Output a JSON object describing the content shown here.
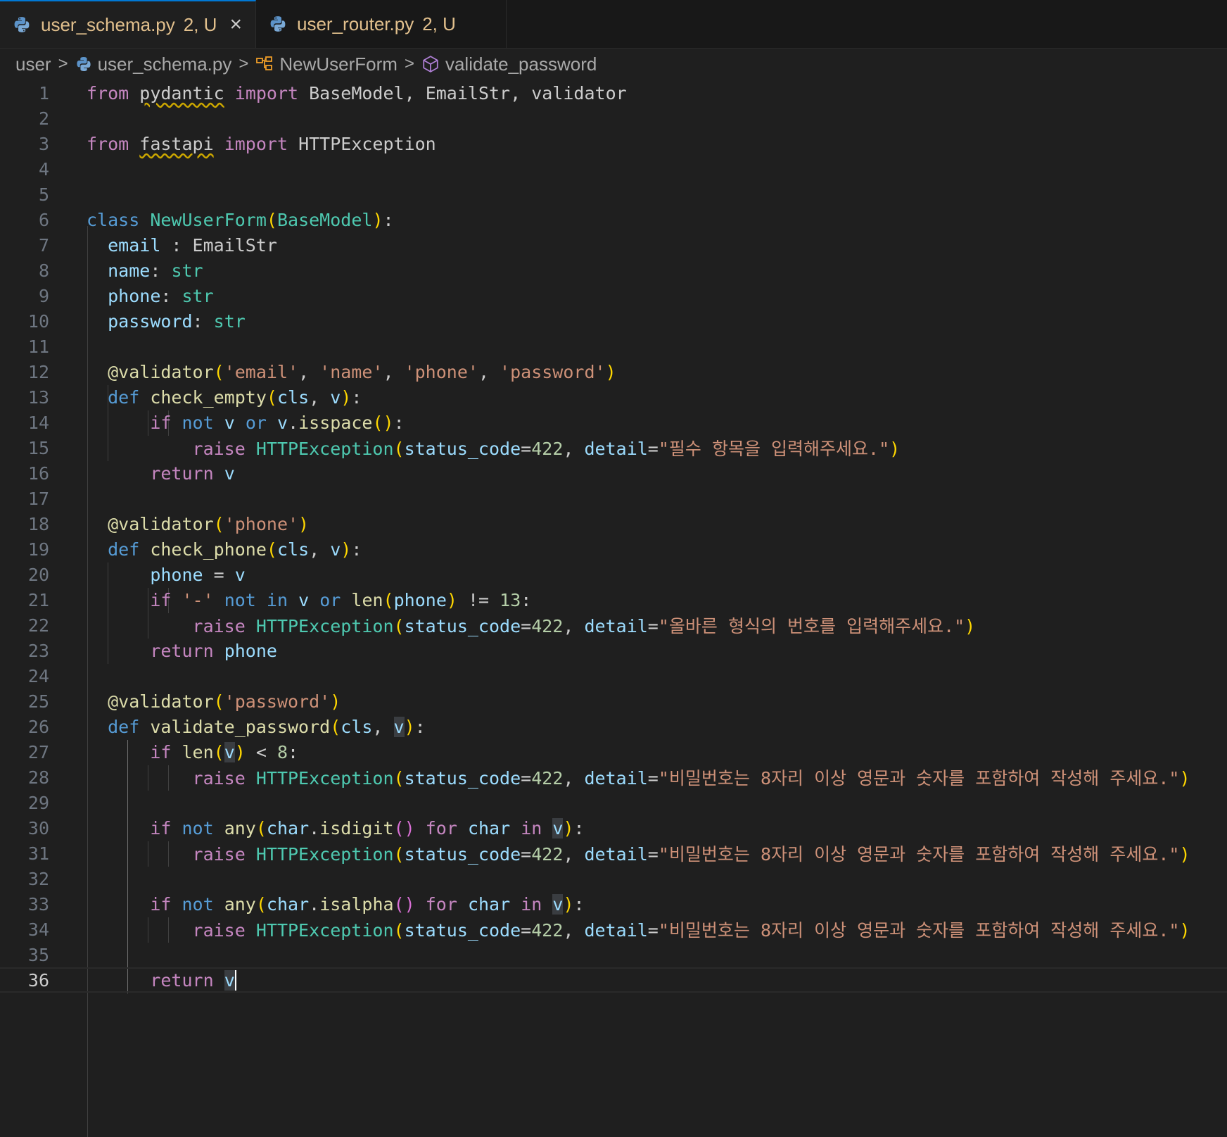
{
  "tabs": [
    {
      "name": "user_schema.py",
      "badge": "2, U",
      "active": true,
      "close": "×"
    },
    {
      "name": "user_router.py",
      "badge": "2, U",
      "active": false
    }
  ],
  "breadcrumb": {
    "folder": "user",
    "file": "user_schema.py",
    "class": "NewUserForm",
    "method": "validate_password"
  },
  "editor": {
    "current_line": 36,
    "line_numbers": [
      "1",
      "2",
      "3",
      "4",
      "5",
      "6",
      "7",
      "8",
      "9",
      "10",
      "11",
      "12",
      "13",
      "14",
      "15",
      "16",
      "17",
      "18",
      "19",
      "20",
      "21",
      "22",
      "23",
      "24",
      "25",
      "26",
      "27",
      "28",
      "29",
      "30",
      "31",
      "32",
      "33",
      "34",
      "35",
      "36"
    ],
    "code": {
      "kw_from": "from",
      "kw_import": "import",
      "mod_pydantic": "pydantic",
      "mod_fastapi": "fastapi",
      "imp1": " BaseModel, EmailStr, validator",
      "imp3": " HTTPException",
      "kw_class": "class",
      "cls_name": "NewUserForm",
      "base": "BaseModel",
      "f_email": "email",
      "t_emailstr": " : EmailStr",
      "f_name": "name",
      "f_phone": "phone",
      "f_password": "password",
      "t_str": "str",
      "dec": "@validator",
      "s_email": "'email'",
      "s_name": "'name'",
      "s_phone": "'phone'",
      "s_password": "'password'",
      "kw_def": "def",
      "fn_check_empty": "check_empty",
      "fn_check_phone": "check_phone",
      "fn_validate_password": "validate_password",
      "p_cls": "cls",
      "p_v": "v",
      "kw_if": "if",
      "kw_not": "not",
      "kw_or": "or",
      "kw_in": "in",
      "kw_for": "for",
      "kw_raise": "raise",
      "kw_return": "return",
      "m_isspace": "isspace",
      "exc": "HTTPException",
      "a_status": "status_code",
      "n_422": "422",
      "a_detail": "detail",
      "msg_required": "\"필수 항목을 입력해주세요.\"",
      "msg_phone": "\"올바른 형식의 번호를 입력해주세요.\"",
      "msg_password": "\"비밀번호는 8자리 이상 영문과 숫자를 포함하여 작성해 주세요.\"",
      "s_dash": "'-'",
      "fn_len": "len",
      "n_13": "13",
      "n_8": "8",
      "fn_any": "any",
      "v_char": "char",
      "m_isdigit": "isdigit",
      "m_isalpha": "isalpha"
    }
  }
}
